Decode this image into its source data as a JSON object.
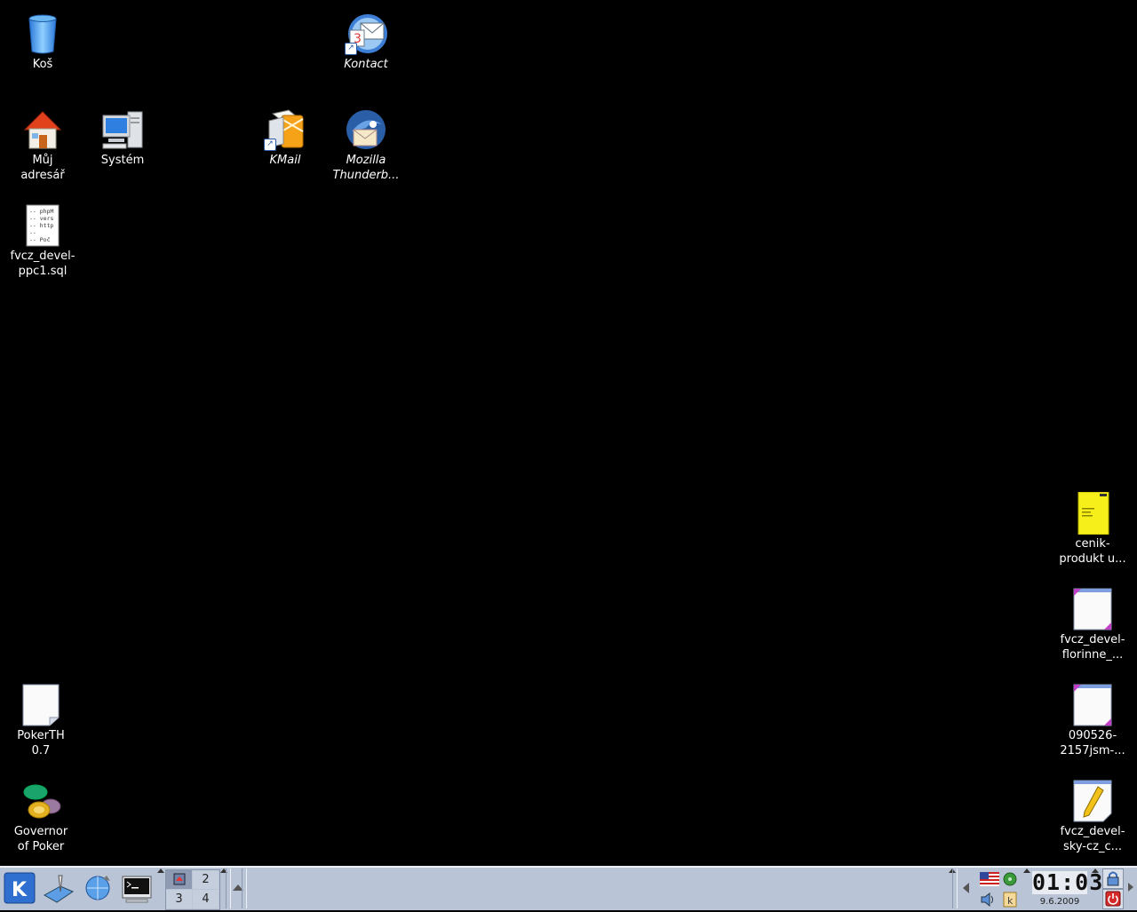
{
  "desktop": {
    "icons": [
      {
        "key": "trash",
        "label": "Koš"
      },
      {
        "key": "kontact",
        "label": "Kontact"
      },
      {
        "key": "home",
        "label": "Můj\nadresář"
      },
      {
        "key": "system",
        "label": "Systém"
      },
      {
        "key": "kmail",
        "label": "KMail"
      },
      {
        "key": "thunderbird",
        "label": "Mozilla\nThunderb..."
      },
      {
        "key": "sqlfile",
        "label": "fvcz_devel-\nppc1.sql"
      },
      {
        "key": "pokerth",
        "label": "PokerTH\n0.7"
      },
      {
        "key": "governor",
        "label": "Governor\nof Poker"
      },
      {
        "key": "cenik",
        "label": "cenik-\nprodukt u..."
      },
      {
        "key": "florinne",
        "label": "fvcz_devel-\nflorinne_..."
      },
      {
        "key": "jsm",
        "label": "090526-\n2157jsm-..."
      },
      {
        "key": "skycz",
        "label": "fvcz_devel-\nsky-cz_c..."
      }
    ],
    "sql_preview_lines": [
      "-- phpM",
      "-- vers",
      "-- http",
      "--",
      "-- Poč"
    ],
    "kontact_badge": "3"
  },
  "taskbar": {
    "pager": [
      "1",
      "2",
      "3",
      "4"
    ],
    "clock_time": "01:03",
    "clock_date": "9.6.2009",
    "kicker_letter": "K",
    "lock_letter": "k"
  },
  "colors": {
    "desktop_bg": "#000000",
    "panel_bg": "#b9c4d6",
    "kde_blue": "#2f6fcf"
  }
}
